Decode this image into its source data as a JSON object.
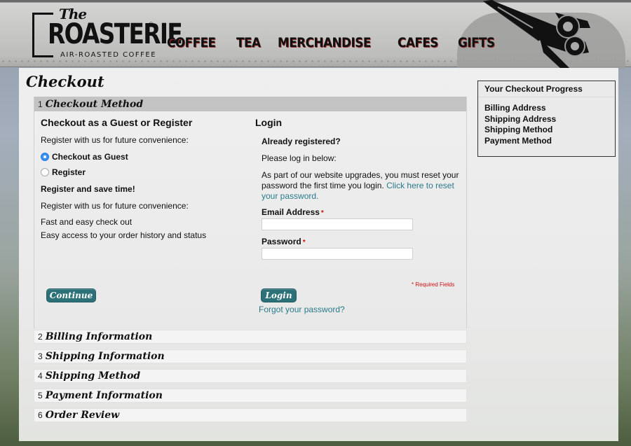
{
  "header": {
    "logo": {
      "the": "The",
      "name": "ROASTERIE",
      "registered": "®",
      "tagline": "AIR-ROASTED COFFEE"
    },
    "nav": [
      "COFFEE",
      "TEA",
      "MERCHANDISE",
      "CAFES",
      "GIFTS"
    ],
    "decoration": "airplane-icon"
  },
  "page": {
    "title": "Checkout"
  },
  "steps": [
    {
      "number": "1",
      "title": "Checkout Method",
      "active": true
    },
    {
      "number": "2",
      "title": "Billing Information",
      "active": false
    },
    {
      "number": "3",
      "title": "Shipping Information",
      "active": false
    },
    {
      "number": "4",
      "title": "Shipping Method",
      "active": false
    },
    {
      "number": "5",
      "title": "Payment Information",
      "active": false
    },
    {
      "number": "6",
      "title": "Order Review",
      "active": false
    }
  ],
  "checkout_method": {
    "guest_section": {
      "heading": "Checkout as a Guest or Register",
      "intro": "Register with us for future convenience:",
      "options": [
        {
          "label": "Checkout as Guest",
          "selected": true
        },
        {
          "label": "Register",
          "selected": false
        }
      ],
      "save_time": "Register and save time!",
      "benefits_intro": "Register with us for future convenience:",
      "benefits": [
        "Fast and easy check out",
        "Easy access to your order history and status"
      ],
      "continue_label": "Continue"
    },
    "login_section": {
      "heading": "Login",
      "already": "Already registered?",
      "please": "Please log in below:",
      "notice": "As part of our website upgrades, you must reset your password the first time you login.",
      "reset_link": "Click here to reset your password.",
      "email_label": "Email Address",
      "email_value": "",
      "password_label": "Password",
      "password_value": "",
      "required_marker": "*",
      "required_note": "* Required Fields",
      "login_label": "Login",
      "forgot_link": "Forgot your password?"
    }
  },
  "progress": {
    "title": "Your Checkout Progress",
    "items": [
      "Billing Address",
      "Shipping Address",
      "Shipping Method",
      "Payment Method"
    ]
  },
  "colors": {
    "button": "#2d7178",
    "link": "#2a7a8a",
    "required": "#d01010",
    "active_step_header": "#c3c3c3"
  }
}
